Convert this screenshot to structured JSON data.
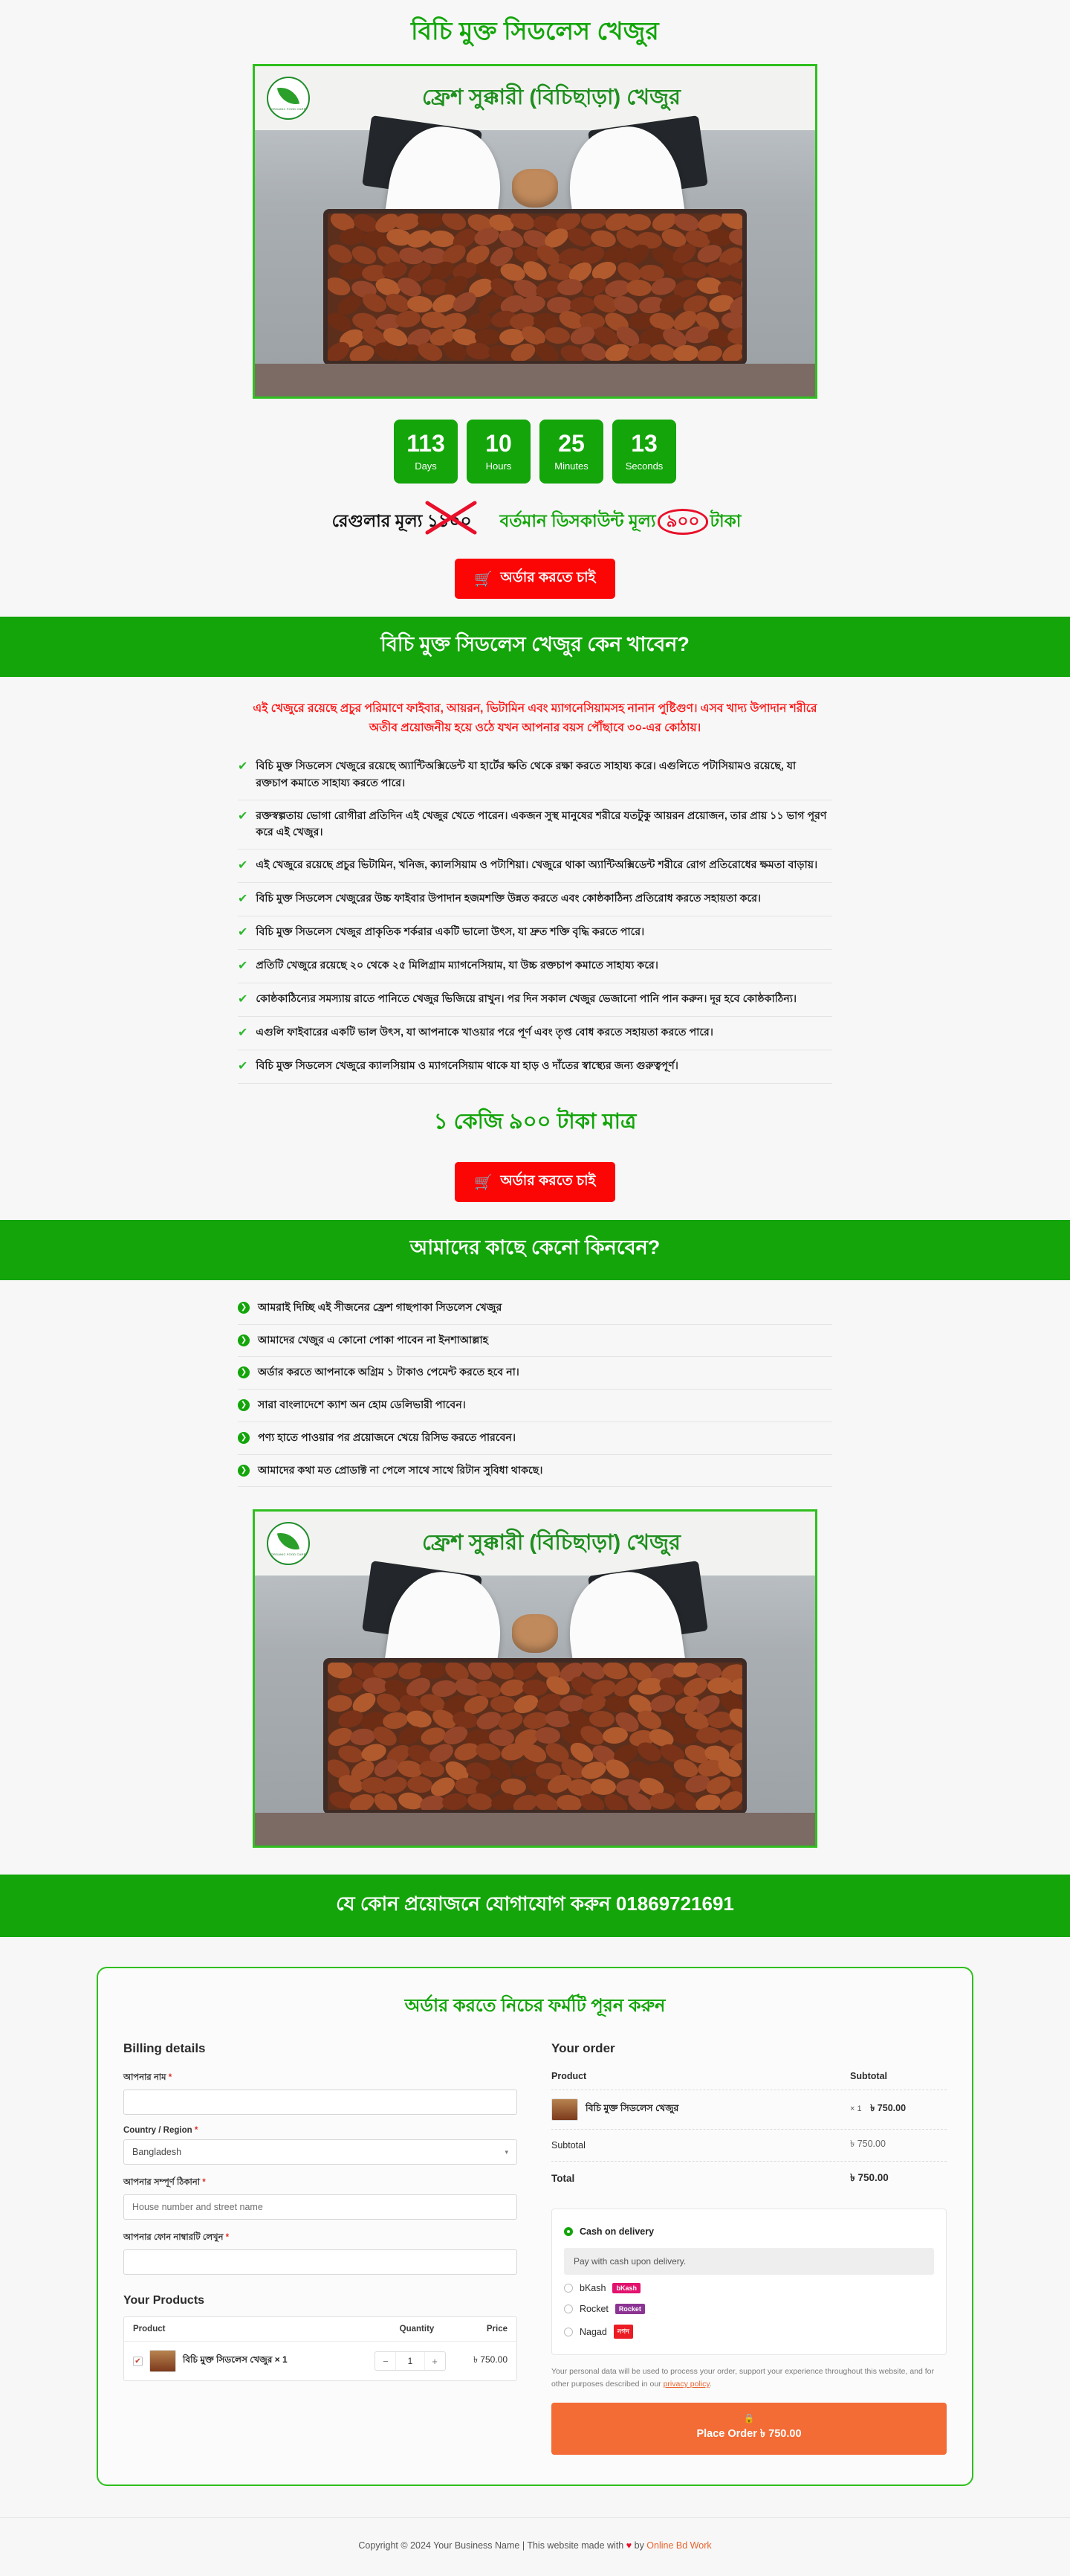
{
  "hero": {
    "title": "বিচি মুক্ত সিডলেস খেজুর",
    "image_caption": "ফ্রেশ সুক্কারী (বিচিছাড়া) খেজুর",
    "logo_text": "ORGANIC FOOD CARE"
  },
  "countdown": {
    "items": [
      {
        "value": "113",
        "label": "Days"
      },
      {
        "value": "10",
        "label": "Hours"
      },
      {
        "value": "25",
        "label": "Minutes"
      },
      {
        "value": "13",
        "label": "Seconds"
      }
    ]
  },
  "pricing": {
    "regular_label": "রেগুলার মূল্য ১১০০",
    "discount_prefix": "বর্তমান ডিসকাউন্ট মূল্য",
    "discount_amount": "৯০০",
    "discount_suffix": "টাকা",
    "per_kg_line": "১ কেজি ৯০০ টাকা মাত্র"
  },
  "cta": {
    "label": "অর্ডার করতে চাই",
    "cart_icon": "cart-icon"
  },
  "why_section": {
    "heading": "বিচি মুক্ত সিডলেস খেজুর কেন খাবেন?",
    "intro": "এই খেজুরে রয়েছে প্রচুর পরিমাণে ফাইবার, আয়রন, ভিটামিন এবং ম্যাগনেসিয়ামসহ নানান পুষ্টিগুণ। এসব খাদ্য উপাদান শরীরে অতীব প্রয়োজনীয় হয়ে ওঠে যখন আপনার বয়স পৌঁছাবে ৩০-এর কোঠায়।",
    "items": [
      "বিচি মুক্ত সিডলেস খেজুরে রয়েছে অ্যান্টিঅক্সিডেন্ট যা হার্টের ক্ষতি থেকে রক্ষা করতে সাহায্য করে। এগুলিতে পটাসিয়ামও রয়েছে, যা রক্তচাপ কমাতে সাহায্য করতে পারে।",
      "রক্তস্বল্পতায় ভোগা রোগীরা প্রতিদিন এই খেজুর খেতে পারেন। একজন সুস্থ মানুষের শরীরে যতটুকু আয়রন প্রয়োজন, তার প্রায় ১১ ভাগ পূরণ করে এই খেজুর।",
      "এই খেজুরে রয়েছে প্রচুর ভিটামিন, খনিজ, ক্যালসিয়াম ও পটাশিয়া। খেজুরে থাকা অ্যান্টিঅক্সিডেন্ট শরীরে রোগ প্রতিরোধের ক্ষমতা বাড়ায়।",
      "বিচি মুক্ত সিডলেস খেজুরের উচ্চ ফাইবার উপাদান হজমশক্তি উন্নত করতে এবং কোষ্ঠকাঠিন্য প্রতিরোধ করতে সহায়তা করে।",
      "বিচি মুক্ত সিডলেস খেজুর প্রাকৃতিক শর্করার একটি ভালো উৎস, যা দ্রুত শক্তি বৃদ্ধি করতে পারে।",
      "প্রতিটি খেজুরে রয়েছে ২০ থেকে ২৫ মিলিগ্রাম ম্যাগনেসিয়াম, যা উচ্চ রক্তচাপ কমাতে সাহায্য করে।",
      "কোষ্ঠকাঠিন্যের সমস্যায় রাতে পানিতে খেজুর ভিজিয়ে রাখুন। পর দিন সকাল খেজুর ভেজানো পানি পান করুন। দূর হবে কোষ্ঠকাঠিন্য।",
      "এগুলি ফাইবারের একটি ভাল উৎস, যা আপনাকে খাওয়ার পরে পূর্ণ এবং তৃপ্ত বোধ করতে সহায়তা করতে পারে।",
      "বিচি মুক্ত সিডলেস খেজুরে ক্যালসিয়াম ও ম্যাগনেসিয়াম থাকে যা হাড় ও দাঁতের স্বাস্থ্যের জন্য গুরুত্বপূর্ণ।"
    ]
  },
  "why_buy_section": {
    "heading": "আমাদের কাছে কেনো কিনবেন?",
    "items": [
      "আমরাই দিচ্ছি এই সীজনের ফ্রেশ গাছপাকা সিডলেস খেজুর",
      "আমাদের খেজুর এ কোনো পোকা পাবেন না ইনশাআল্লাহ",
      "অর্ডার করতে আপনাকে অগ্রিম ১ টাকাও পেমেন্ট করতে হবে না।",
      "সারা বাংলাদেশে ক্যাশ অন হোম ডেলিভারী পাবেন।",
      "পণ্য হাতে পাওয়ার পর প্রয়োজনে খেয়ে রিসিভ করতে পারবেন।",
      "আমাদের কথা মত প্রোডাক্ট না পেলে সাথে সাথে রিটান সুবিধা থাকছে।"
    ]
  },
  "contact_bar": {
    "text": "যে কোন প্রয়োজনে যোগাযোগ করুন 01869721691"
  },
  "checkout": {
    "title": "অর্ডার করতে নিচের ফর্মটি পূরন করুন",
    "billing_heading": "Billing details",
    "fields": [
      {
        "label": "আপনার নাম",
        "required": "*",
        "value": "",
        "placeholder": ""
      },
      {
        "label": "Country / Region",
        "required": "*",
        "value": "Bangladesh",
        "placeholder": ""
      },
      {
        "label": "আপনার সম্পূর্ণ ঠিকানা",
        "required": "*",
        "value": "",
        "placeholder": "House number and street name"
      },
      {
        "label": "আপনার ফোন নাম্বারটি লেখুন",
        "required": "*",
        "value": "",
        "placeholder": ""
      }
    ],
    "your_products_heading": "Your Products",
    "products_table": {
      "headers": {
        "product": "Product",
        "quantity": "Quantity",
        "price": "Price"
      },
      "rows": [
        {
          "name": "বিচি মুক্ত সিডলেস খেজুর × 1",
          "qty": "1",
          "price": "৳ 750.00",
          "checked": true
        }
      ]
    },
    "order_heading": "Your order",
    "order_table": {
      "headers": {
        "product": "Product",
        "subtotal": "Subtotal"
      },
      "line_item": {
        "name": "বিচি মুক্ত সিডলেস খেজুর",
        "qty": "× 1",
        "amount": "৳ 750.00"
      },
      "subtotal_label": "Subtotal",
      "subtotal_value": "৳ 750.00",
      "total_label": "Total",
      "total_value": "৳ 750.00"
    },
    "payment": {
      "selected": "Cash on delivery",
      "cod_label": "Cash on delivery",
      "cod_note": "Pay with cash upon delivery.",
      "methods": [
        {
          "name": "bKash",
          "badge": "bKash"
        },
        {
          "name": "Rocket",
          "badge": "Rocket"
        },
        {
          "name": "Nagad",
          "badge": "নগদ"
        }
      ]
    },
    "privacy_text_1": "Your personal data will be used to process your order, support your experience throughout this website, and for other purposes described in our ",
    "privacy_link": "privacy policy",
    "privacy_text_2": ".",
    "place_order_label": "Place Order",
    "place_order_amount": "৳ 750.00",
    "lock_icon": "lock-icon"
  },
  "footer": {
    "prefix": "Copyright © 2024 Your Business Name | This website made with ",
    "heart": "♥",
    "mid": " by ",
    "brand": "Online Bd Work"
  },
  "colors": {
    "green": "#13a50a",
    "red": "#fb0505",
    "orange": "#f36b35",
    "bkash": "#e2136e",
    "rocket": "#8c3494",
    "nagad": "#ec1c24"
  }
}
